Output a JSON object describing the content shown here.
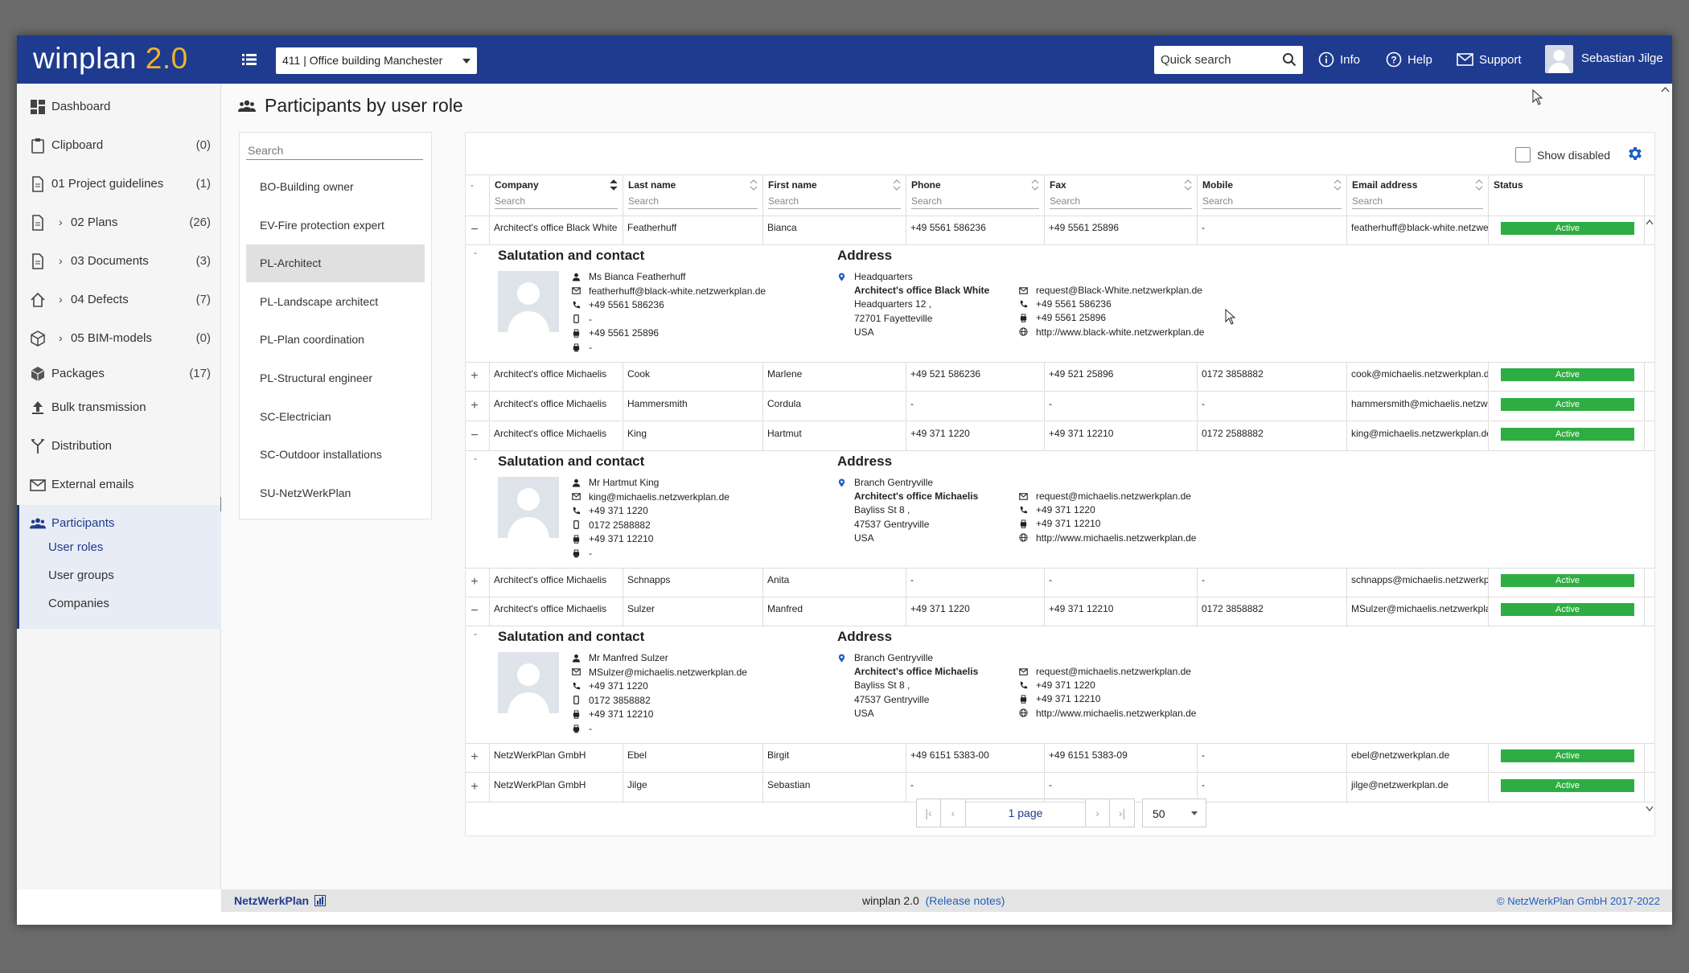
{
  "app": {
    "logo_main": "winplan",
    "logo_version": "2.0"
  },
  "topbar": {
    "project": "411 | Office building Manchester",
    "quick_search": "Quick search",
    "info": "Info",
    "help": "Help",
    "support": "Support",
    "user": "Sebastian Jilge"
  },
  "sidebar": {
    "items": [
      {
        "label": "Dashboard",
        "count": ""
      },
      {
        "label": "Clipboard",
        "count": "(0)"
      },
      {
        "label": "01 Project guidelines",
        "count": "(1)"
      },
      {
        "label": "02 Plans",
        "count": "(26)"
      },
      {
        "label": "03 Documents",
        "count": "(3)"
      },
      {
        "label": "04 Defects",
        "count": "(7)"
      },
      {
        "label": "05 BIM-models",
        "count": "(0)"
      },
      {
        "label": "Packages",
        "count": "(17)"
      },
      {
        "label": "Bulk transmission",
        "count": ""
      },
      {
        "label": "Distribution",
        "count": ""
      },
      {
        "label": "External emails",
        "count": ""
      },
      {
        "label": "Participants",
        "count": ""
      }
    ],
    "sub": [
      "User roles",
      "User groups",
      "Companies"
    ]
  },
  "page": {
    "title": "Participants by user role"
  },
  "roles": {
    "search": "Search",
    "items": [
      "BO-Building owner",
      "EV-Fire protection expert",
      "PL-Architect",
      "PL-Landscape architect",
      "PL-Plan coordination",
      "PL-Structural engineer",
      "SC-Electrician",
      "SC-Outdoor installations",
      "SU-NetzWerkPlan"
    ]
  },
  "table": {
    "show_disabled": "Show disabled",
    "columns": [
      "Company",
      "Last name",
      "First name",
      "Phone",
      "Fax",
      "Mobile",
      "Email address",
      "Status"
    ],
    "search_placeholder": "Search",
    "rows": [
      {
        "sign": "−",
        "company": "Architect's office Black White",
        "last": "Featherhuff",
        "first": "Bianca",
        "phone": "+49 5561 586236",
        "fax": "+49 5561 25896",
        "mobile": "-",
        "email": "featherhuff@black-white.netzwer",
        "status": "Active"
      },
      {
        "sign": "+",
        "company": "Architect's office Michaelis",
        "last": "Cook",
        "first": "Marlene",
        "phone": "+49 521 586236",
        "fax": "+49 521 25896",
        "mobile": "0172 3858882",
        "email": "cook@michaelis.netzwerkplan.de",
        "status": "Active"
      },
      {
        "sign": "+",
        "company": "Architect's office Michaelis",
        "last": "Hammersmith",
        "first": "Cordula",
        "phone": "-",
        "fax": "-",
        "mobile": "-",
        "email": "hammersmith@michaelis.netzwe",
        "status": "Active"
      },
      {
        "sign": "−",
        "company": "Architect's office Michaelis",
        "last": "King",
        "first": "Hartmut",
        "phone": "+49 371 1220",
        "fax": "+49 371 12210",
        "mobile": "0172 2588882",
        "email": "king@michaelis.netzwerkplan.de",
        "status": "Active"
      },
      {
        "sign": "+",
        "company": "Architect's office Michaelis",
        "last": "Schnapps",
        "first": "Anita",
        "phone": "-",
        "fax": "-",
        "mobile": "-",
        "email": "schnapps@michaelis.netzwerkpl",
        "status": "Active"
      },
      {
        "sign": "−",
        "company": "Architect's office Michaelis",
        "last": "Sulzer",
        "first": "Manfred",
        "phone": "+49 371 1220",
        "fax": "+49 371 12210",
        "mobile": "0172 3858882",
        "email": "MSulzer@michaelis.netzwerkpla",
        "status": "Active"
      },
      {
        "sign": "+",
        "company": "NetzWerkPlan GmbH",
        "last": "Ebel",
        "first": "Birgit",
        "phone": "+49 6151 5383-00",
        "fax": "+49 6151 5383-09",
        "mobile": "-",
        "email": "ebel@netzwerkplan.de",
        "status": "Active"
      },
      {
        "sign": "+",
        "company": "NetzWerkPlan GmbH",
        "last": "Jilge",
        "first": "Sebastian",
        "phone": "-",
        "fax": "-",
        "mobile": "-",
        "email": "jilge@netzwerkplan.de",
        "status": "Active"
      }
    ],
    "details": [
      {
        "h_contact": "Salutation and contact",
        "h_address": "Address",
        "contact": [
          "Ms Bianca Featherhuff",
          "featherhuff@black-white.netzwerkplan.de",
          "+49 5561 586236",
          "-",
          "+49 5561 25896",
          "-"
        ],
        "addr": [
          "Headquarters",
          "Architect's office Black White",
          "Headquarters 12 ,",
          "72701 Fayetteville",
          "USA"
        ],
        "comm": [
          "request@Black-White.netzwerkplan.de",
          "+49 5561 586236",
          "+49 5561 25896",
          "http://www.black-white.netzwerkplan.de"
        ]
      },
      {
        "h_contact": "Salutation and contact",
        "h_address": "Address",
        "contact": [
          "Mr Hartmut King",
          "king@michaelis.netzwerkplan.de",
          "+49 371 1220",
          "0172 2588882",
          "+49 371 12210",
          "-"
        ],
        "addr": [
          "Branch Gentryville",
          "Architect's office Michaelis",
          "Bayliss St 8 ,",
          "47537 Gentryville",
          "USA"
        ],
        "comm": [
          "request@michaelis.netzwerkplan.de",
          "+49 371 1220",
          "+49 371 12210",
          "http://www.michaelis.netzwerkplan.de"
        ]
      },
      {
        "h_contact": "Salutation and contact",
        "h_address": "Address",
        "contact": [
          "Mr Manfred Sulzer",
          "MSulzer@michaelis.netzwerkplan.de",
          "+49 371 1220",
          "0172 3858882",
          "+49 371 12210",
          "-"
        ],
        "addr": [
          "Branch Gentryville",
          "Architect's office Michaelis",
          "Bayliss St 8 ,",
          "47537 Gentryville",
          "USA"
        ],
        "comm": [
          "request@michaelis.netzwerkplan.de",
          "+49 371 1220",
          "+49 371 12210",
          "http://www.michaelis.netzwerkplan.de"
        ]
      }
    ],
    "pager": {
      "label": "1 page",
      "size": "50"
    }
  },
  "footer": {
    "brand": "NetzWerkPlan",
    "version": "winplan 2.0",
    "release": "(Release notes)",
    "copyright": "© NetzWerkPlan GmbH 2017-2022"
  },
  "colors": {
    "header": "#1f3b8f",
    "accent": "#f0b429",
    "active": "#2eae42"
  }
}
